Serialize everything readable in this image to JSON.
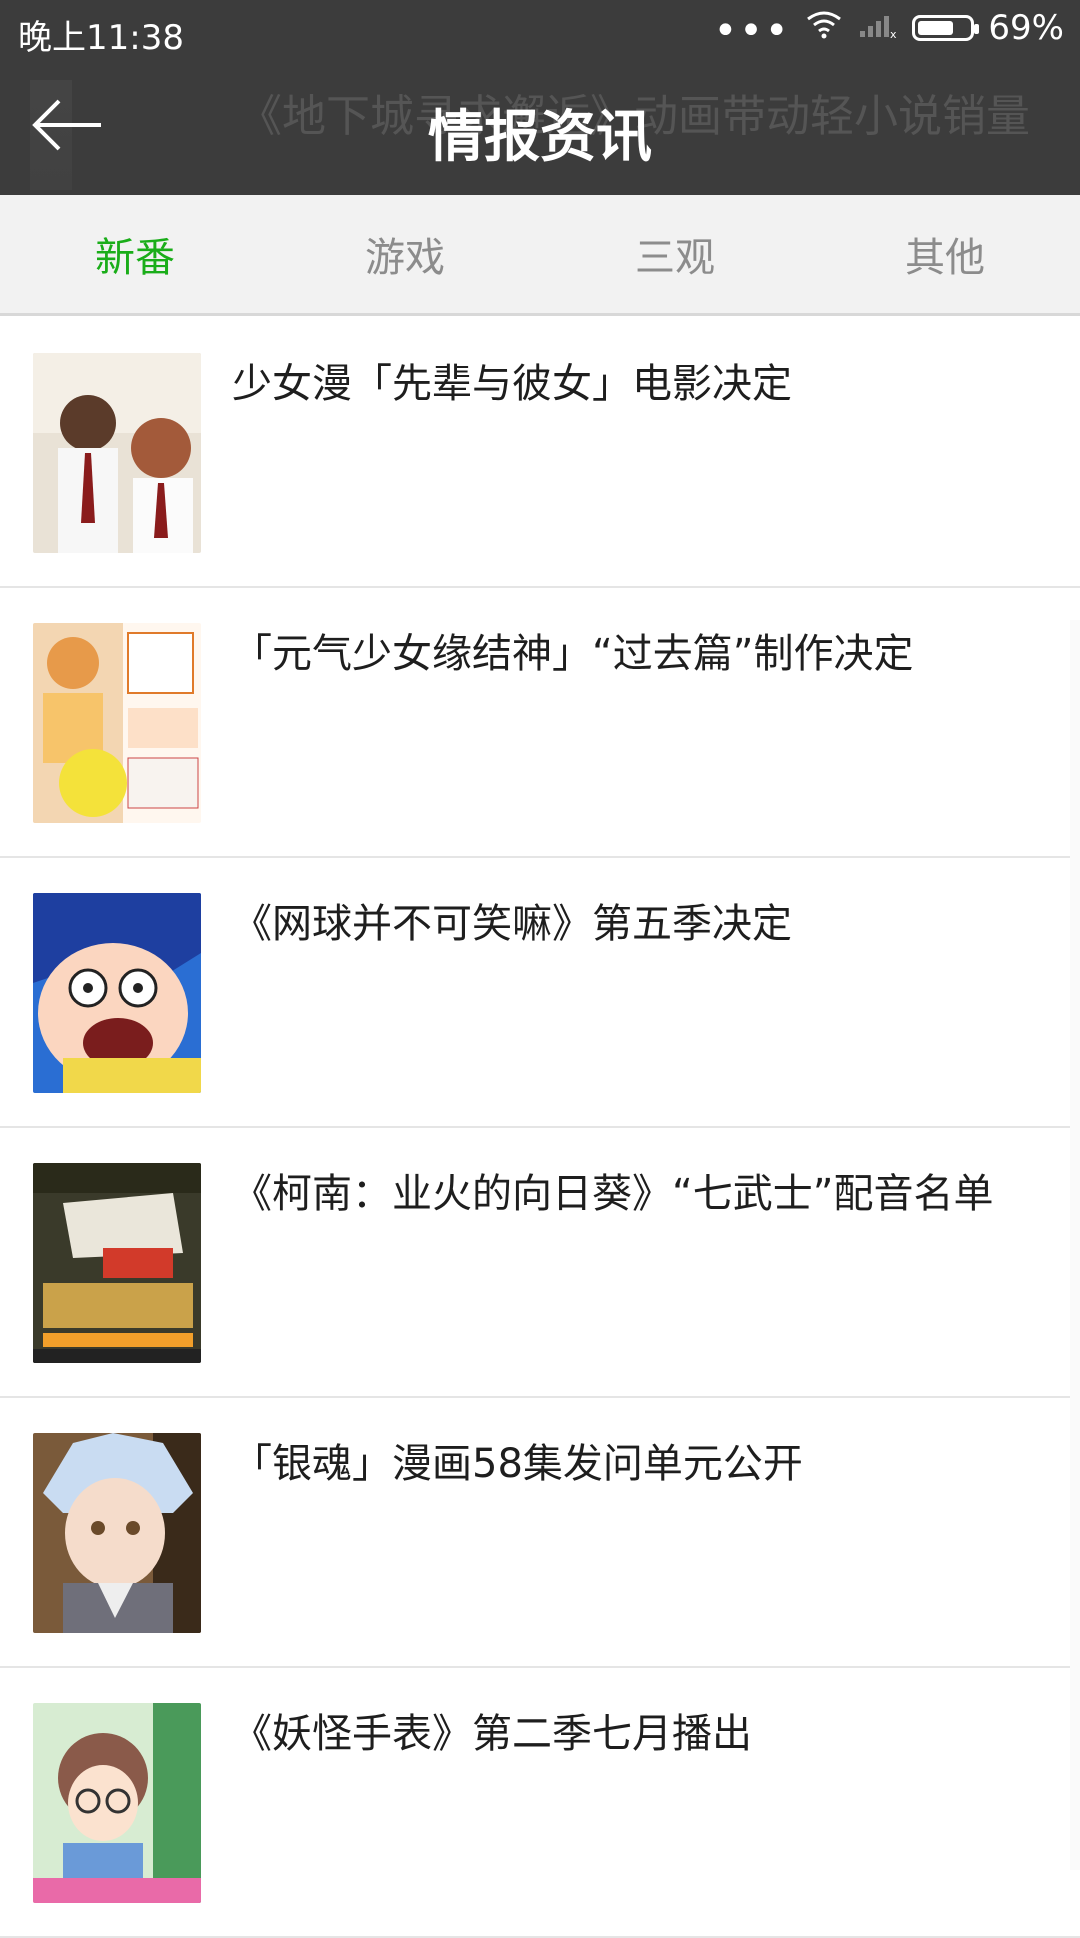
{
  "status_bar": {
    "time": "晚上11:38",
    "battery_percent_label": "69%",
    "battery_level": 0.69
  },
  "header": {
    "title": "情报资讯",
    "background_title": "《地下城寻求邂逅》动画带动轻小说销量"
  },
  "tabs": [
    {
      "label": "新番",
      "active": true
    },
    {
      "label": "游戏",
      "active": false
    },
    {
      "label": "三观",
      "active": false
    },
    {
      "label": "其他",
      "active": false
    }
  ],
  "colors": {
    "accent": "#1aad19",
    "header_bg": "#3c3c3c",
    "tab_inactive": "#8c8c8c"
  },
  "news": [
    {
      "title": "少女漫「先辈与彼女」电影决定",
      "thumb": "photo-couple-thumbnail"
    },
    {
      "title": "「元气少女缘结神」“过去篇”制作决定",
      "thumb": "manga-cover-thumbnail"
    },
    {
      "title": "《网球并不可笑嘛》第五季决定",
      "thumb": "anime-character-thumbnail"
    },
    {
      "title": "《柯南：业火的向日葵》“七武士”配音名单",
      "thumb": "movie-poster-thumbnail"
    },
    {
      "title": "「银魂」漫画58集发问单元公开",
      "thumb": "anime-character-thumbnail"
    },
    {
      "title": "《妖怪手表》第二季七月播出",
      "thumb": "anime-character-thumbnail"
    }
  ]
}
